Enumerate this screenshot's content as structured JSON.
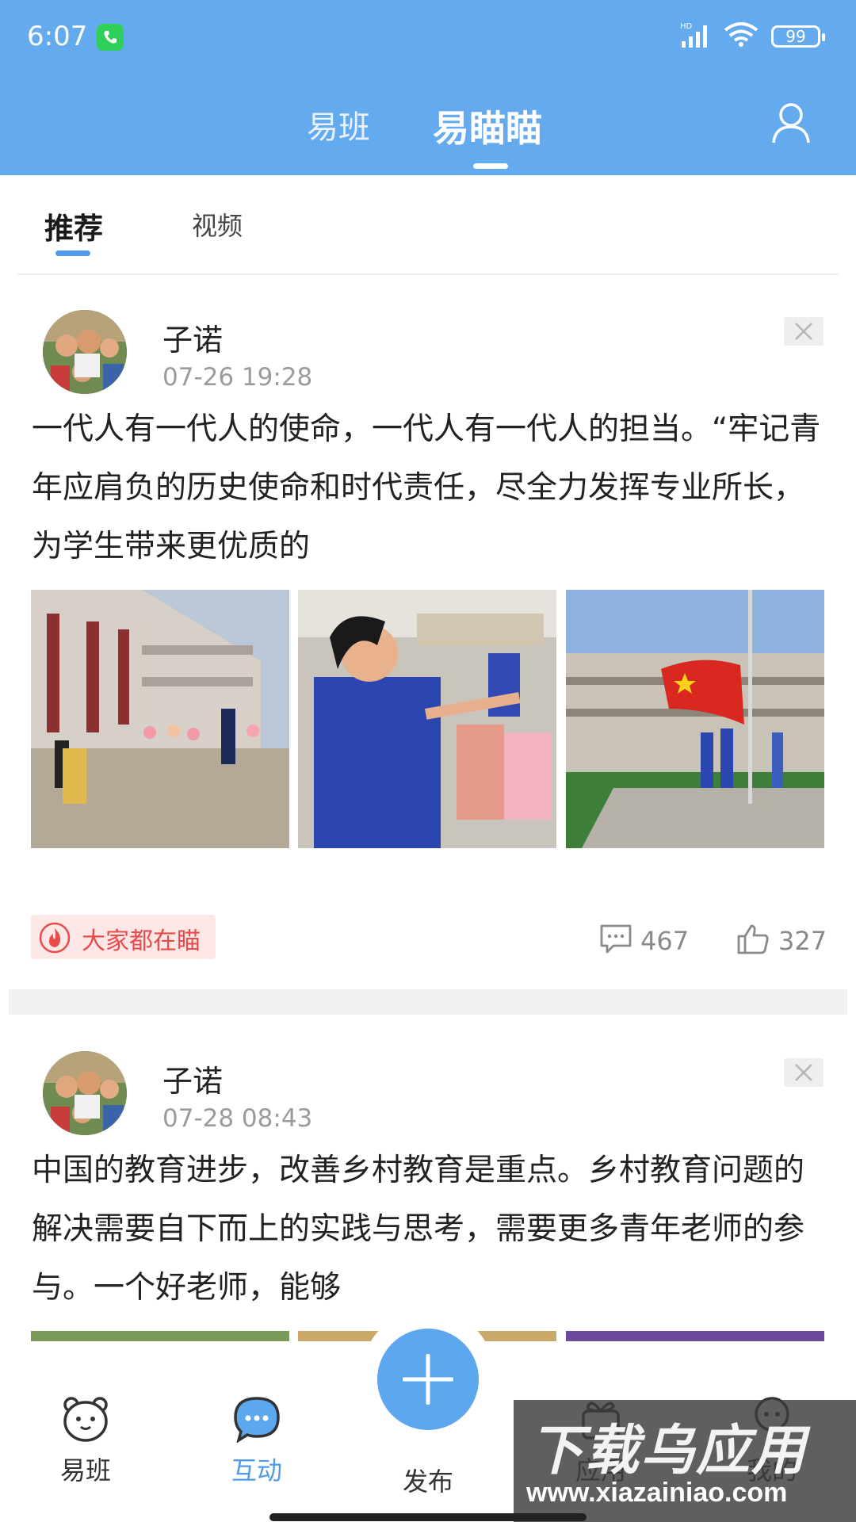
{
  "status_bar": {
    "time": "6:07",
    "battery": "99"
  },
  "top_tabs": [
    {
      "label": "易班"
    },
    {
      "label": "易瞄瞄"
    }
  ],
  "sub_tabs": [
    {
      "label": "推荐"
    },
    {
      "label": "视频"
    }
  ],
  "posts": [
    {
      "author": "子诺",
      "time": "07-26 19:28",
      "text": "一代人有一代人的使命，一代人有一代人的担当。“牢记青年应肩负的历史使命和时代责任，尽全力发挥专业所长，为学生带来更优质的",
      "tag": "大家都在瞄",
      "comments": "467",
      "likes": "327"
    },
    {
      "author": "子诺",
      "time": "07-28 08:43",
      "text": "中国的教育进步，改善乡村教育是重点。乡村教育问题的解决需要自下而上的实践与思考，需要更多青年老师的参与。一个好老师，能够"
    }
  ],
  "bottom_nav": [
    {
      "label": "易班",
      "icon": "bear-icon"
    },
    {
      "label": "互动",
      "icon": "chat-bubble-icon"
    },
    {
      "label": "发布",
      "icon": "plus-icon"
    },
    {
      "label": "应用",
      "icon": "gift-icon"
    },
    {
      "label": "我的",
      "icon": "person-icon"
    }
  ],
  "watermark": {
    "title": "下载乌应用",
    "url": "www.xiazainiao.com"
  },
  "colors": {
    "header": "#64aaee",
    "accent": "#4f9bea",
    "hot": "#e94b4b"
  }
}
